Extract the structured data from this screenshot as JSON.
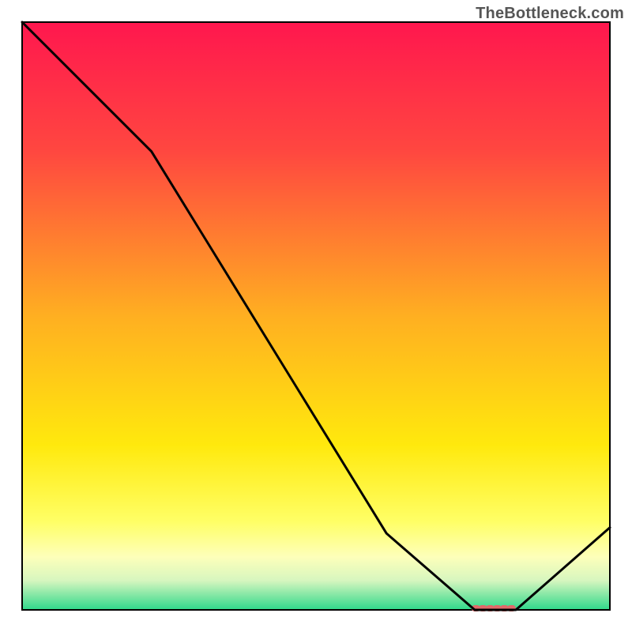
{
  "attribution": "TheBottleneck.com",
  "chart_data": {
    "type": "line",
    "title": "",
    "xlabel": "",
    "ylabel": "",
    "x": [
      0,
      22,
      62,
      77,
      84,
      100
    ],
    "values": [
      100,
      78,
      13,
      0,
      0,
      14
    ],
    "xlim": [
      0,
      100
    ],
    "ylim": [
      0,
      100
    ],
    "grid": false,
    "highlight_range": {
      "x_start": 77,
      "x_end": 84,
      "color": "#e06a6a"
    },
    "background_gradient": {
      "stops": [
        {
          "offset": 0,
          "color": "#ff174e"
        },
        {
          "offset": 22,
          "color": "#ff4740"
        },
        {
          "offset": 50,
          "color": "#ffaf21"
        },
        {
          "offset": 72,
          "color": "#ffe90d"
        },
        {
          "offset": 85,
          "color": "#ffff66"
        },
        {
          "offset": 91,
          "color": "#fdffba"
        },
        {
          "offset": 95,
          "color": "#d7f6bf"
        },
        {
          "offset": 100,
          "color": "#2fd88b"
        }
      ]
    }
  }
}
